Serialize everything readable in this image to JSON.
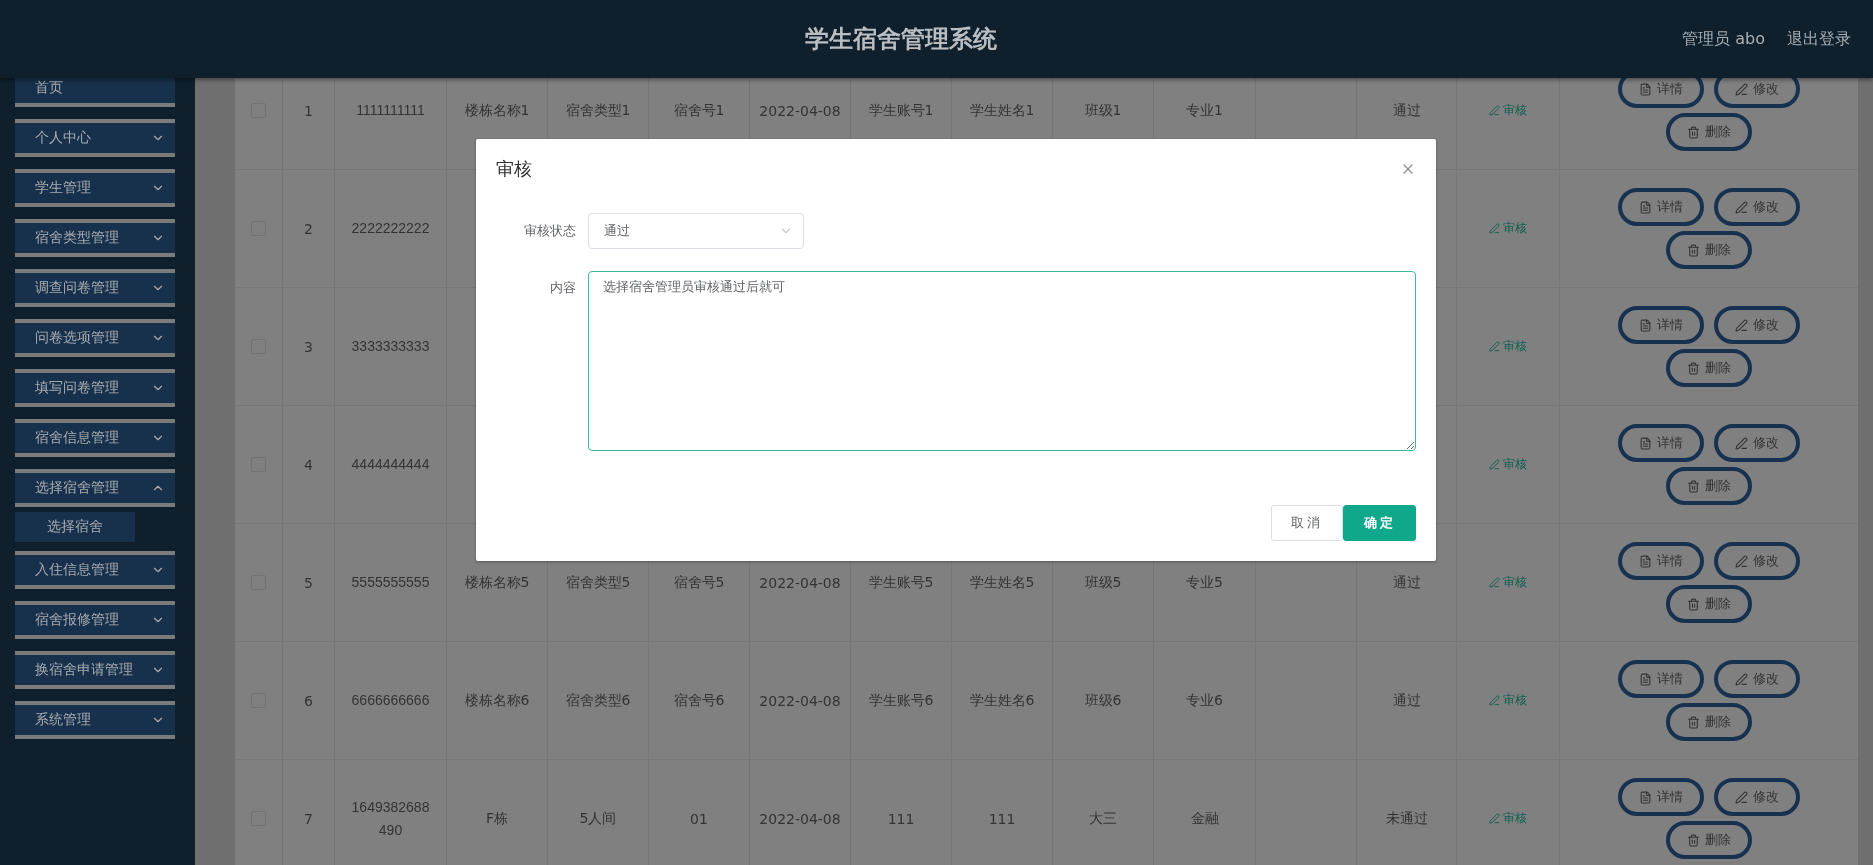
{
  "header": {
    "title": "学生宿舍管理系统",
    "user": "管理员 abo",
    "logout": "退出登录"
  },
  "sidebar": {
    "items": [
      {
        "label": "首页",
        "kind": "link"
      },
      {
        "label": "个人中心",
        "kind": "menu",
        "expanded": false
      },
      {
        "label": "学生管理",
        "kind": "menu",
        "expanded": false
      },
      {
        "label": "宿舍类型管理",
        "kind": "menu",
        "expanded": false
      },
      {
        "label": "调查问卷管理",
        "kind": "menu",
        "expanded": false
      },
      {
        "label": "问卷选项管理",
        "kind": "menu",
        "expanded": false
      },
      {
        "label": "填写问卷管理",
        "kind": "menu",
        "expanded": false
      },
      {
        "label": "宿舍信息管理",
        "kind": "menu",
        "expanded": false
      },
      {
        "label": "选择宿舍管理",
        "kind": "menu",
        "expanded": true,
        "children": [
          {
            "label": "选择宿舍"
          }
        ]
      },
      {
        "label": "入住信息管理",
        "kind": "menu",
        "expanded": false
      },
      {
        "label": "宿舍报修管理",
        "kind": "menu",
        "expanded": false
      },
      {
        "label": "换宿舍申请管理",
        "kind": "menu",
        "expanded": false
      },
      {
        "label": "系统管理",
        "kind": "menu",
        "expanded": false
      }
    ]
  },
  "table": {
    "rows": [
      {
        "checked": false,
        "index": "1",
        "id": "1111111111",
        "building": "楼栋名称1",
        "type": "宿舍类型1",
        "room": "宿舍号1",
        "date": "2022-04-08",
        "account": "学生账号1",
        "name": "学生姓名1",
        "class": "班级1",
        "major": "专业1",
        "status": "通过",
        "review": "审核",
        "actions": [
          "详情",
          "修改",
          "删除"
        ]
      },
      {
        "checked": false,
        "index": "2",
        "id": "2222222222",
        "review": "审核",
        "actions": [
          "详情",
          "修改",
          "删除"
        ]
      },
      {
        "checked": false,
        "index": "3",
        "id": "3333333333",
        "review": "审核",
        "actions": [
          "详情",
          "修改",
          "删除"
        ]
      },
      {
        "checked": false,
        "index": "4",
        "id": "4444444444",
        "review": "审核",
        "actions": [
          "详情",
          "修改",
          "删除"
        ]
      },
      {
        "checked": false,
        "index": "5",
        "id": "5555555555",
        "building": "楼栋名称5",
        "type": "宿舍类型5",
        "room": "宿舍号5",
        "date": "2022-04-08",
        "account": "学生账号5",
        "name": "学生姓名5",
        "class": "班级5",
        "major": "专业5",
        "status": "通过",
        "review": "审核",
        "actions": [
          "详情",
          "修改",
          "删除"
        ]
      },
      {
        "checked": false,
        "index": "6",
        "id": "6666666666",
        "building": "楼栋名称6",
        "type": "宿舍类型6",
        "room": "宿舍号6",
        "date": "2022-04-08",
        "account": "学生账号6",
        "name": "学生姓名6",
        "class": "班级6",
        "major": "专业6",
        "status": "通过",
        "review": "审核",
        "actions": [
          "详情",
          "修改",
          "删除"
        ]
      },
      {
        "checked": false,
        "index": "7",
        "id": "1649382688490",
        "building": "F栋",
        "type": "5人间",
        "room": "01",
        "date": "2022-04-08",
        "account": "111",
        "name": "111",
        "class": "大三",
        "major": "金融",
        "status": "未通过",
        "review": "审核",
        "actions": [
          "详情",
          "修改",
          "删除"
        ]
      }
    ]
  },
  "dialog": {
    "title": "审核",
    "fields": [
      {
        "label": "审核状态",
        "kind": "select",
        "value": "通过"
      },
      {
        "label": "内容",
        "kind": "textarea",
        "value": "选择宿舍管理员审核通过后就可"
      }
    ],
    "buttons": [
      {
        "label": "取消",
        "kind": "default"
      },
      {
        "label": "确定",
        "kind": "primary"
      }
    ]
  }
}
